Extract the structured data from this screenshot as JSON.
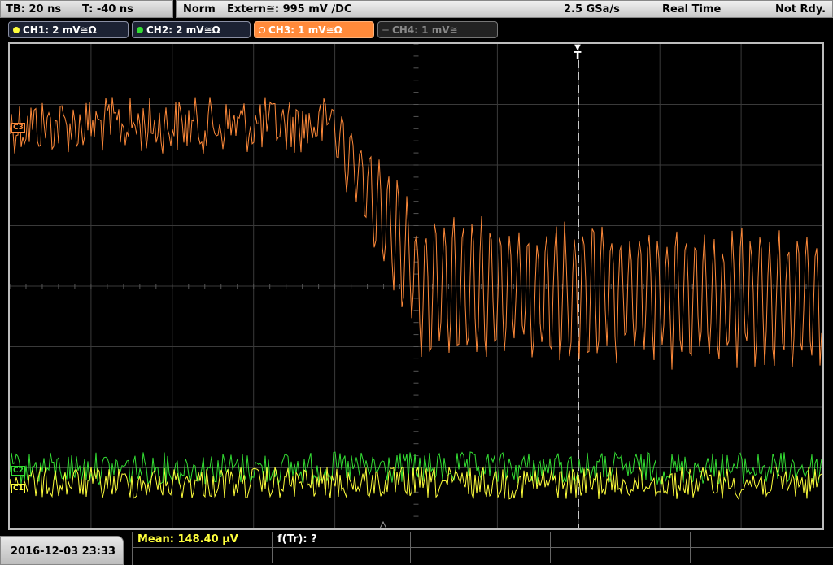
{
  "timebase": {
    "tb": "TB: 20 ns",
    "t": "T: -40 ns"
  },
  "trigger_info": {
    "mode": "Norm",
    "source": "Extern≅: 995 mV ∕DC",
    "sample_rate": "2.5 GSa/s",
    "acq_mode": "Real Time",
    "status": "Not Rdy."
  },
  "channels": [
    {
      "label": "CH1: 2 mV≅Ω",
      "color": "#ffff3c",
      "active": true
    },
    {
      "label": "CH2: 2 mV≅Ω",
      "color": "#33dd33",
      "active": true
    },
    {
      "label": "CH3: 1 mV≅Ω",
      "color": "#ff8a3a",
      "active": true,
      "selected": true
    },
    {
      "label": "CH4: 1 mV≅",
      "color": "#777777",
      "active": false
    }
  ],
  "trigger_marker": {
    "label": "T"
  },
  "channel_markers": {
    "ch3": "C3",
    "ch2": "C2",
    "ch1": "C1"
  },
  "datetime": "2016-12-03 23:33",
  "measurements": {
    "mean": "Mean: 148.40 μV",
    "f_tr": "f(Tr): ?"
  },
  "colors": {
    "ch1": "#ffff3c",
    "ch2": "#33dd33",
    "ch3": "#ff8a3a",
    "grid": "#3a3a3a",
    "background": "#000000"
  }
}
